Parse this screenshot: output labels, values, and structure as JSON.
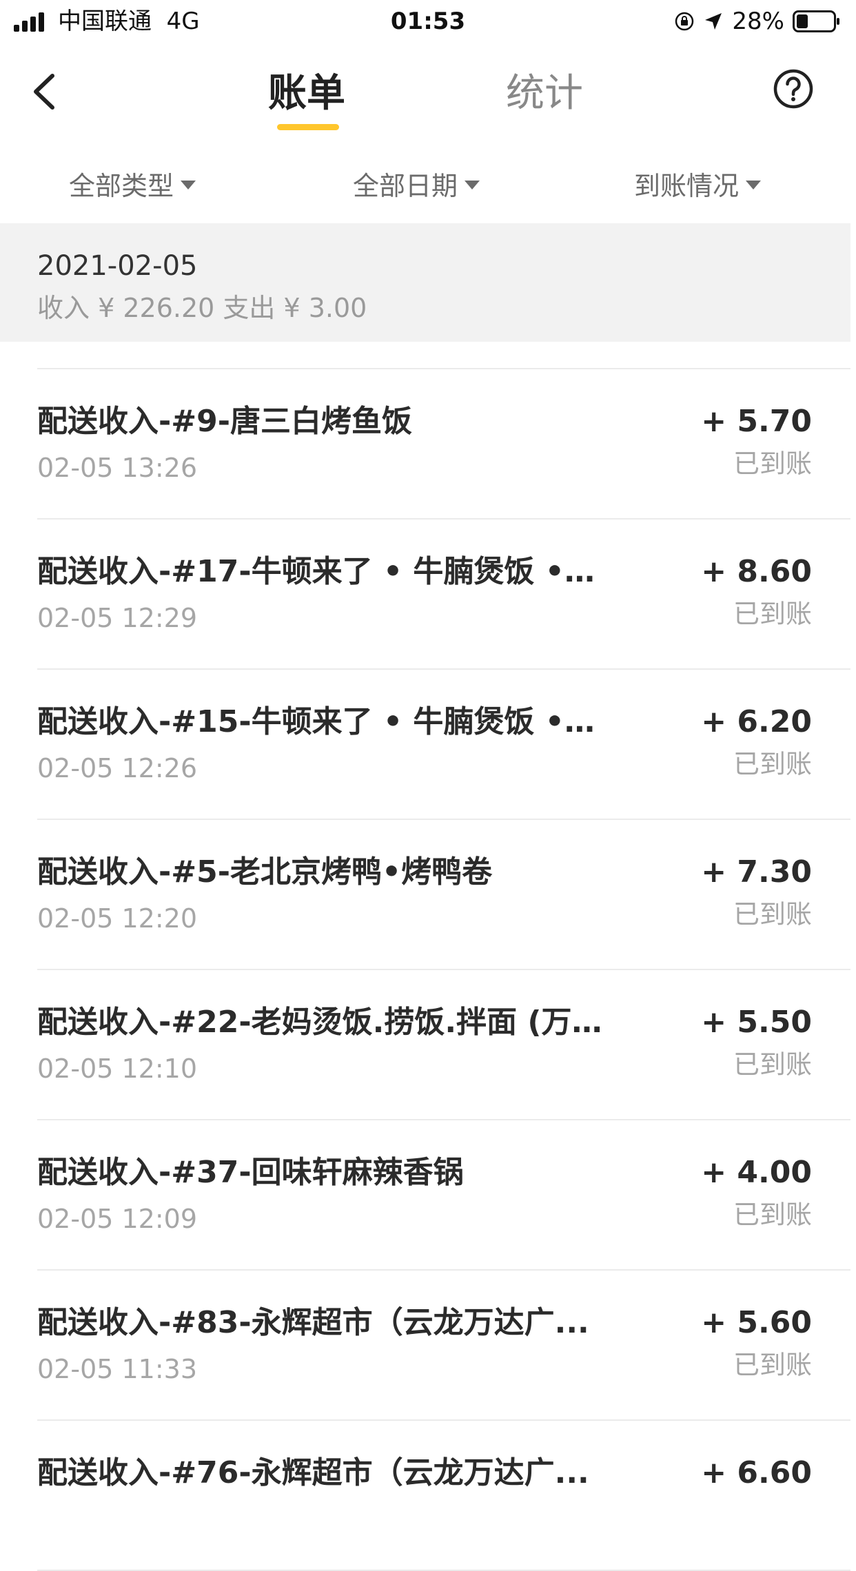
{
  "status_bar": {
    "carrier": "中国联通",
    "network": "4G",
    "time": "01:53",
    "battery": "28%"
  },
  "nav": {
    "tabs": [
      "账单",
      "统计"
    ],
    "active_tab": "账单",
    "accent_color": "#ffc62c"
  },
  "filters": [
    "全部类型",
    "全部日期",
    "到账情况"
  ],
  "section": {
    "date": "2021-02-05",
    "summary": "收入 ¥ 226.20 支出 ¥ 3.00"
  },
  "transactions": [
    {
      "title": "配送收入-#9-唐三白烤鱼饭",
      "time": "02-05 13:26",
      "amount": "+ 5.70",
      "status": "已到账"
    },
    {
      "title": "配送收入-#17-牛顿来了 • 牛腩煲饭 • ...",
      "time": "02-05 12:29",
      "amount": "+ 8.60",
      "status": "已到账"
    },
    {
      "title": "配送收入-#15-牛顿来了 • 牛腩煲饭 • ...",
      "time": "02-05 12:26",
      "amount": "+ 6.20",
      "status": "已到账"
    },
    {
      "title": "配送收入-#5-老北京烤鸭•烤鸭卷",
      "time": "02-05 12:20",
      "amount": "+ 7.30",
      "status": "已到账"
    },
    {
      "title": "配送收入-#22-老妈烫饭.捞饭.拌面 (万...",
      "time": "02-05 12:10",
      "amount": "+ 5.50",
      "status": "已到账"
    },
    {
      "title": "配送收入-#37-回味轩麻辣香锅",
      "time": "02-05 12:09",
      "amount": "+ 4.00",
      "status": "已到账"
    },
    {
      "title": "配送收入-#83-永辉超市（云龙万达广...",
      "time": "02-05 11:33",
      "amount": "+ 5.60",
      "status": "已到账"
    },
    {
      "title": "配送收入-#76-永辉超市（云龙万达广...",
      "time": "",
      "amount": "+ 6.60",
      "status": ""
    }
  ]
}
